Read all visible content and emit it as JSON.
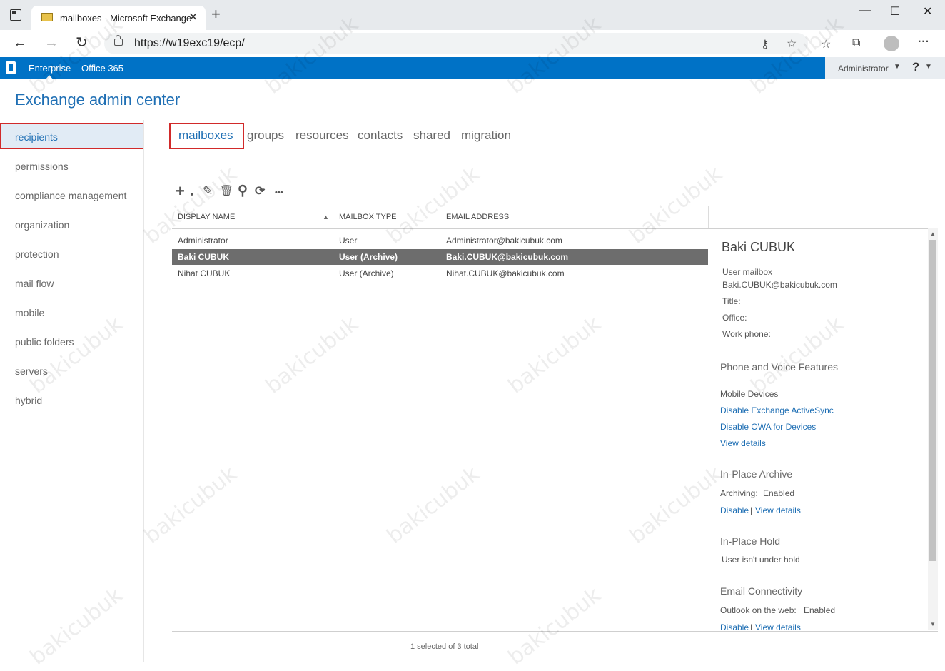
{
  "browser": {
    "tab_title": "mailboxes - Microsoft Exchange",
    "tab_close": "✕",
    "new_tab": "+",
    "url": "https://w19exc19/ecp/",
    "window_controls": {
      "minimize": "—",
      "maximize": "☐",
      "close": "✕"
    }
  },
  "topbar": {
    "items": [
      "Enterprise",
      "Office 365"
    ],
    "user": "Administrator",
    "help": "?"
  },
  "app_title": "Exchange admin center",
  "sidebar": {
    "items": [
      {
        "label": "recipients"
      },
      {
        "label": "permissions"
      },
      {
        "label": "compliance management"
      },
      {
        "label": "organization"
      },
      {
        "label": "protection"
      },
      {
        "label": "mail flow"
      },
      {
        "label": "mobile"
      },
      {
        "label": "public folders"
      },
      {
        "label": "servers"
      },
      {
        "label": "hybrid"
      }
    ]
  },
  "tabs": [
    "mailboxes",
    "groups",
    "resources",
    "contacts",
    "shared",
    "migration"
  ],
  "toolbar": {
    "add": "+",
    "edit": "✎",
    "delete": "🗑",
    "search": "⚲",
    "refresh": "⟳",
    "more": "•••"
  },
  "table": {
    "columns": [
      "DISPLAY NAME",
      "MAILBOX TYPE",
      "EMAIL ADDRESS"
    ],
    "sort_indicator": "▲",
    "rows": [
      {
        "name": "Administrator",
        "type": "User",
        "email": "Administrator@bakicubuk.com"
      },
      {
        "name": "Baki CUBUK",
        "type": "User (Archive)",
        "email": "Baki.CUBUK@bakicubuk.com"
      },
      {
        "name": "Nihat CUBUK",
        "type": "User (Archive)",
        "email": "Nihat.CUBUK@bakicubuk.com"
      }
    ],
    "status": "1 selected of 3 total"
  },
  "details": {
    "name": "Baki CUBUK",
    "kind": "User mailbox",
    "email": "Baki.CUBUK@bakicubuk.com",
    "title_label": "Title:",
    "office_label": "Office:",
    "work_phone_label": "Work phone:",
    "phone_voice_heading": "Phone and Voice Features",
    "mobile_devices_label": "Mobile Devices",
    "disable_eas": "Disable Exchange ActiveSync",
    "disable_owa_devices": "Disable OWA for Devices",
    "view_details": "View details",
    "archive_heading": "In-Place Archive",
    "archiving_label": "Archiving:",
    "archiving_value": "Enabled",
    "disable": "Disable",
    "separator": "|",
    "hold_heading": "In-Place Hold",
    "hold_value": "User isn't under hold",
    "email_conn_heading": "Email Connectivity",
    "owa_label": "Outlook on the web:",
    "owa_value": "Enabled"
  },
  "watermark": "bakicubuk"
}
